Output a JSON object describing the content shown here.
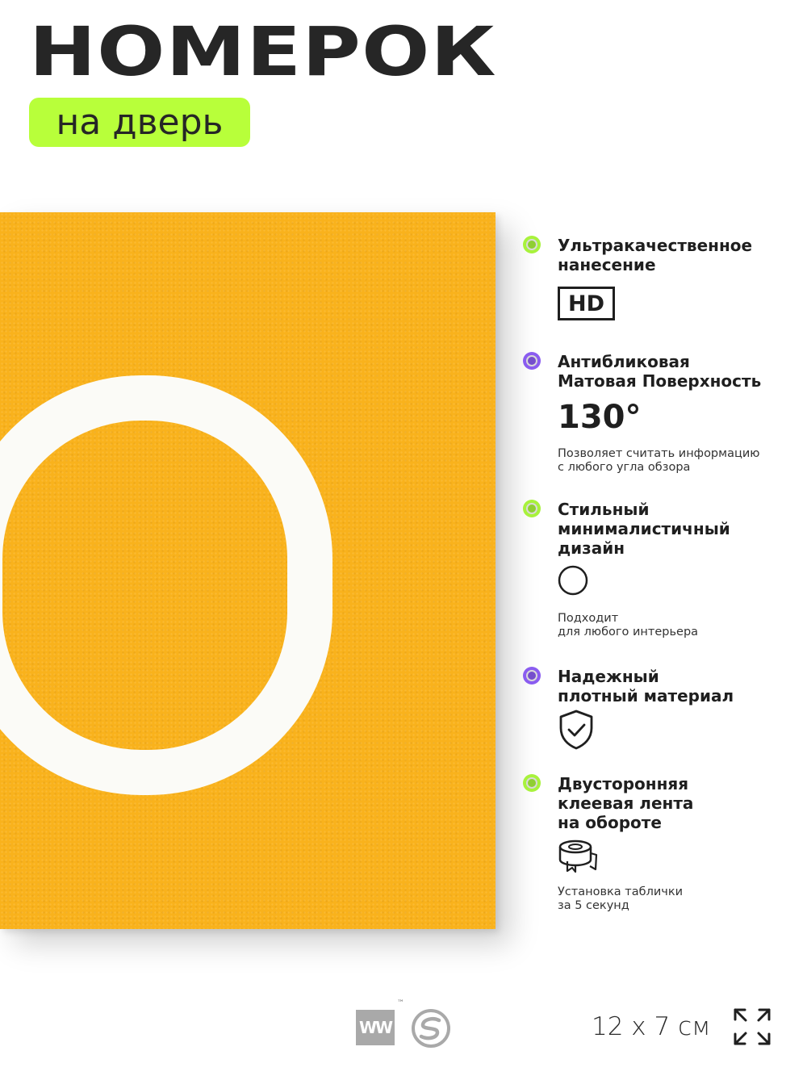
{
  "header": {
    "title": "НОМЕРОК",
    "subtitle": "на дверь"
  },
  "sign": {
    "digit": "0",
    "background_color": "#f9b21c",
    "digit_color": "#ffffff"
  },
  "features": [
    {
      "title": "Ультракачественное\nнанесение",
      "badge": "HD",
      "bullet_color": "#a8f23c"
    },
    {
      "title": "Антибликовая\nМатовая Поверхность",
      "value": "130°",
      "note": "Позволяет считать информацию\nс любого угла обзора",
      "bullet_color": "#8a5cf0"
    },
    {
      "title": "Стильный\nминималистичный\nдизайн",
      "icon": "circle-icon",
      "note": "Подходит\nдля любого интерьера",
      "bullet_color": "#a8f23c"
    },
    {
      "title": "Надежный\nплотный материал",
      "icon": "shield-check-icon",
      "bullet_color": "#8a5cf0"
    },
    {
      "title": "Двусторонняя\nклеевая лента\nна обороте",
      "icon": "tape-roll-icon",
      "note": "Установка таблички\nза 5 секунд",
      "bullet_color": "#a8f23c"
    }
  ],
  "footer": {
    "brand_logo_text": "W",
    "trademark": "™",
    "size": "12 x 7 см",
    "expand_icon": "expand-arrows-icon"
  }
}
